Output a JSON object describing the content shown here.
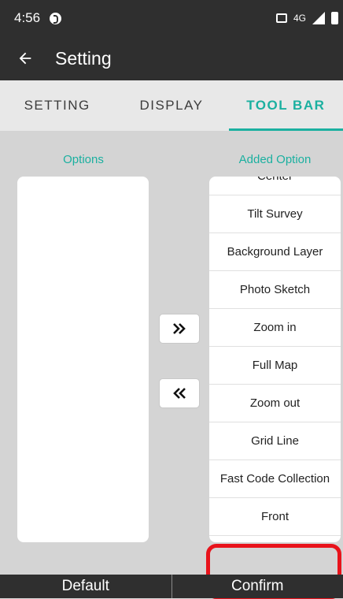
{
  "status_bar": {
    "time": "4:56",
    "network": "4G",
    "icons": [
      "notification-icon",
      "vibrate-icon",
      "signal-icon",
      "battery-icon"
    ]
  },
  "app_bar": {
    "title": "Setting",
    "back_icon": "arrow-left-icon"
  },
  "tabs": [
    {
      "label": "SETTING",
      "active": false
    },
    {
      "label": "DISPLAY",
      "active": false
    },
    {
      "label": "TOOL BAR",
      "active": true
    }
  ],
  "panel": {
    "options_label": "Options",
    "added_label": "Added Option",
    "options_items": [],
    "added_items": [
      "Center",
      "Tilt Survey",
      "Background Layer",
      "Photo Sketch",
      "Zoom in",
      "Full Map",
      "Zoom out",
      "Grid Line",
      "Fast Code Collection",
      "Front"
    ],
    "highlighted_item": "Front",
    "move_right_label": "»",
    "move_left_label": "«"
  },
  "bottom_bar": {
    "default_label": "Default",
    "confirm_label": "Confirm"
  },
  "colors": {
    "accent": "#1bb0a0",
    "bar": "#2f2f2f",
    "highlight": "#e8131b"
  }
}
